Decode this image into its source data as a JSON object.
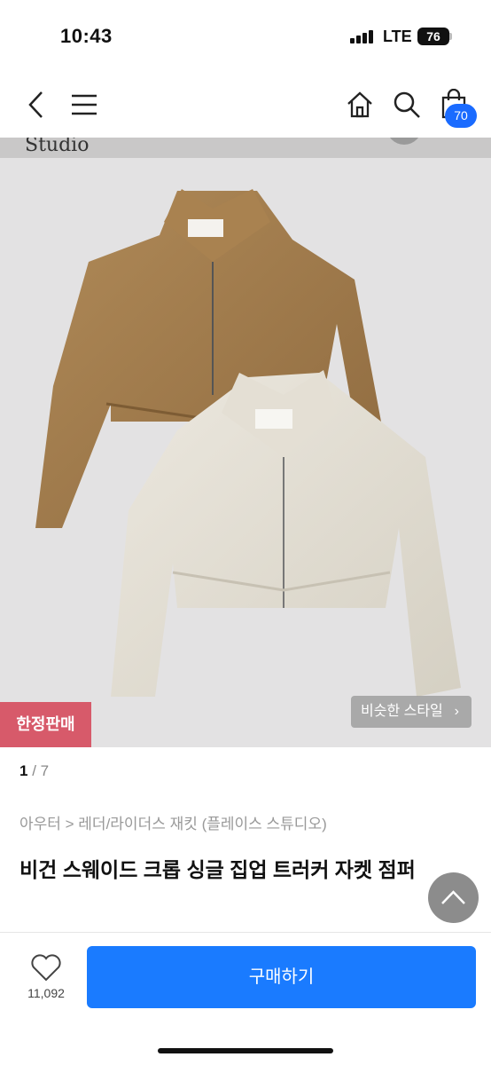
{
  "status_bar": {
    "time": "10:43",
    "network": "LTE",
    "battery": "76"
  },
  "header": {
    "icons": [
      "back-icon",
      "menu-icon",
      "home-icon",
      "search-icon",
      "cart-icon"
    ],
    "cart_count": "70"
  },
  "product_image": {
    "partial_text": "Studio",
    "limited_badge": "한정판매",
    "similar_button": "비슷한 스타일",
    "similar_chevron": "›",
    "pager_current": "1",
    "pager_total": "7"
  },
  "product": {
    "breadcrumb": "아우터 > 레더/라이더스 재킷 (플레이스 스튜디오)",
    "title": "비건 스웨이드 크롭 싱글 집업 트러커 자켓 점퍼"
  },
  "bottom": {
    "like_count": "11,092",
    "buy_label": "구매하기"
  },
  "colors": {
    "accent": "#1a7bff",
    "badge_pink": "#d75a6a",
    "cart_badge": "#1a6bff"
  }
}
